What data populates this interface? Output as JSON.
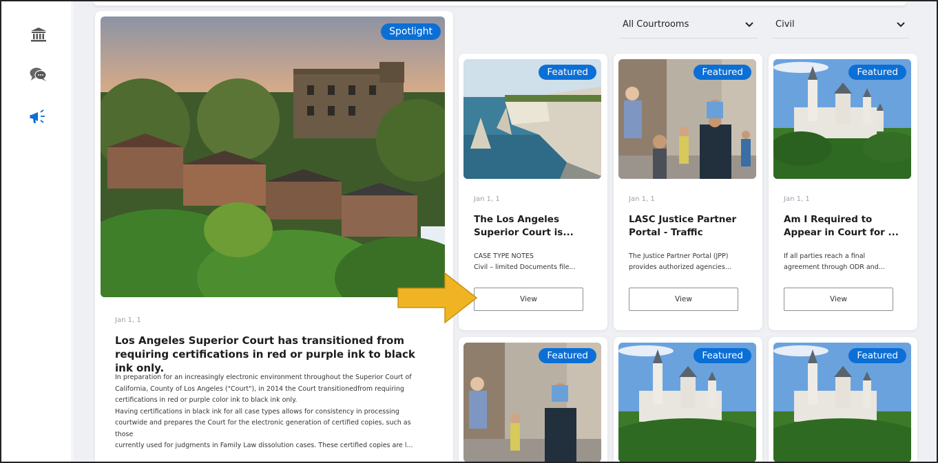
{
  "sidebar": {
    "items": [
      {
        "icon": "courthouse-icon"
      },
      {
        "icon": "chat-icon"
      },
      {
        "icon": "megaphone-icon"
      }
    ]
  },
  "filters": {
    "courtroom": "All Courtrooms",
    "case_type": "Civil"
  },
  "spotlight": {
    "badge": "Spotlight",
    "date": "Jan 1, 1",
    "title": "Los Angeles Superior Court has transitioned from requiring certifications in red or purple ink to black ink only.",
    "body": [
      "In preparation for an increasingly electronic environment throughout the Superior Court of\nCalifornia, County of Los Angeles (\"Court\"), in 2014 the Court transitionedfrom requiring\ncertifications in red or purple color ink to black ink only.",
      "Having certifications in black ink for all case types allows for consistency in processing\ncourtwide and prepares the Court for the electronic generation of certified copies, such as\nthose",
      "currently used for judgments in Family Law dissolution cases. These certified copies are l..."
    ]
  },
  "cards": [
    {
      "badge": "Featured",
      "date": "Jan 1, 1",
      "title": "The Los Angeles Superior Court is...",
      "desc_line1": "CASE TYPE NOTES",
      "desc_line2": "Civil – limited Documents file...",
      "button": "View"
    },
    {
      "badge": "Featured",
      "date": "Jan 1, 1",
      "title": "LASC Justice Partner Portal - Traffic",
      "desc_line1": "The Justice Partner Portal (JPP)",
      "desc_line2": "provides authorized agencies...",
      "button": "View"
    },
    {
      "badge": "Featured",
      "date": "Jan 1, 1",
      "title": "Am I Required to Appear in Court for ...",
      "desc_line1": "If all parties reach a final",
      "desc_line2": "agreement through ODR and...",
      "button": "View"
    },
    {
      "badge": "Featured"
    },
    {
      "badge": "Featured"
    },
    {
      "badge": "Featured"
    }
  ],
  "colors": {
    "accent": "#0b6fd6",
    "arrow": "#f0b323",
    "background": "#eef0f4"
  }
}
